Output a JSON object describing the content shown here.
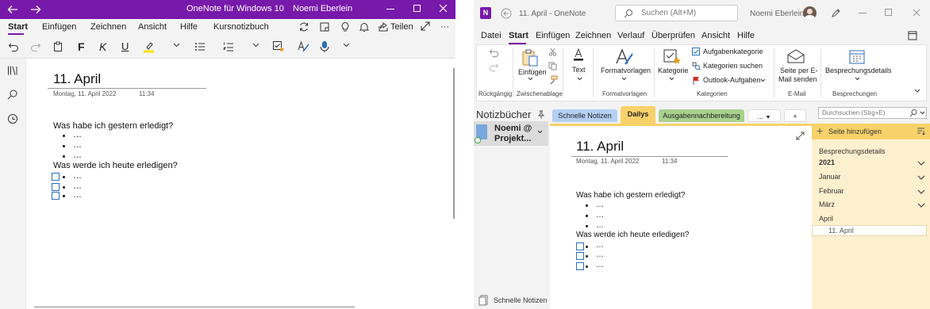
{
  "left_app": {
    "title": "OneNote für Windows 10",
    "user": "Noemi Eberlein",
    "menu": [
      "Start",
      "Einfügen",
      "Zeichnen",
      "Ansicht",
      "Hilfe",
      "Kursnotizbuch"
    ],
    "share_label": "Teilen",
    "toolbar": {
      "bold": "F",
      "italic": "K",
      "underline": "U"
    },
    "page": {
      "title": "11. April",
      "date": "Montag, 11. April 2022",
      "time": "11:34",
      "q1": "Was habe ich gestern erledigt?",
      "q2": "Was werde ich heute erledigen?",
      "ellipsis": "…"
    }
  },
  "right_app": {
    "title": "11. April  -  OneNote",
    "search_placeholder": "Suchen (Alt+M)",
    "user": "Noemi Eberlein",
    "menu": [
      "Datei",
      "Start",
      "Einfügen",
      "Zeichnen",
      "Verlauf",
      "Überprüfen",
      "Ansicht",
      "Hilfe"
    ],
    "ribbon": {
      "undo_group": "Rückgängig",
      "paste": "Einfügen",
      "clipboard_group": "Zwischenablage",
      "text": "Text",
      "styles": "Formatvorlagen",
      "styles_group": "Formatvorlagen",
      "category": "Kategorie",
      "task_category": "Aufgabenkategorie",
      "find_categories": "Kategorien suchen",
      "outlook_tasks": "Outlook-Aufgaben",
      "categories_group": "Kategorien",
      "email_line1": "Seite per E-",
      "email_line2": "Mail senden",
      "email_group": "E-Mail",
      "meeting_details": "Besprechungsdetails",
      "meetings_group": "Besprechungen"
    },
    "notebooks_header": "Notizbücher",
    "notebook_name_1": "Noemi @",
    "notebook_name_2": "Projekt...",
    "quick_notes": "Schnelle Notizen",
    "tabs": [
      "Schnelle Notizen",
      "Dailys",
      "Ausgabennachbereitung",
      "...",
      "+"
    ],
    "search_box": "Durchsuchen (Strg+E)",
    "add_page": "Seite hinzufügen",
    "pages": [
      "Besprechungsdetails",
      "2021",
      "Januar",
      "Februar",
      "März",
      "April",
      "11. April"
    ],
    "page": {
      "title": "11. April",
      "date": "Montag, 11. April 2022",
      "time": "11:34",
      "q1": "Was habe ich gestern erledigt?",
      "q2": "Was werde ich heute erledigen?",
      "ellipsis": "…"
    },
    "colors": {
      "tab_quick": "#b4d0f3",
      "tab_dailys": "#f7d26a",
      "tab_ausgaben": "#a9d18e",
      "purple": "#7719aa"
    }
  }
}
